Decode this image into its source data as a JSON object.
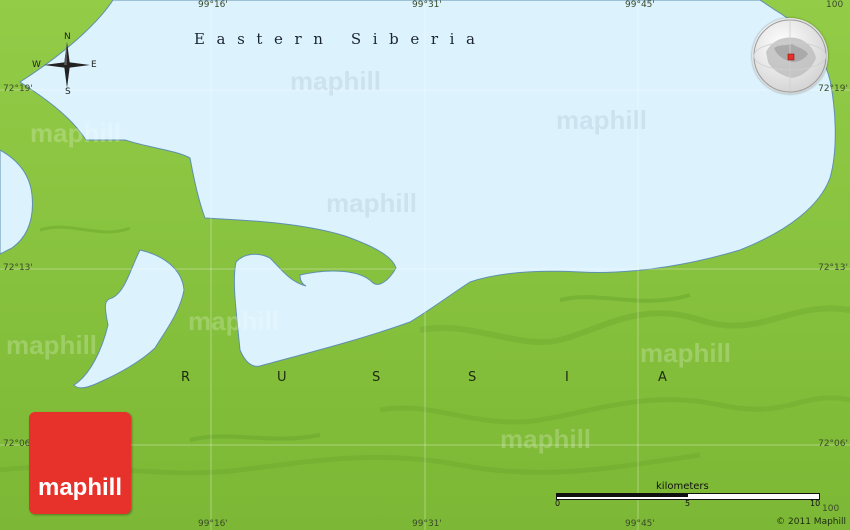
{
  "map": {
    "water_label": "Eastern Siberia",
    "country_label": "RUSSIA",
    "country_letters": [
      "R",
      "U",
      "S",
      "S",
      "I",
      "A"
    ],
    "watermark": "maphill",
    "colors": {
      "land": "#8cc63f",
      "water": "#dcf3fd",
      "coastline": "#5f8fb0",
      "grid": "#a9c89a",
      "logo": "#e7322b"
    }
  },
  "coords": {
    "top": [
      "99°16'",
      "99°31'",
      "99°45'",
      "100"
    ],
    "bottom": [
      "99°16'",
      "99°31'",
      "99°45'",
      "100"
    ],
    "left": [
      "72°19'",
      "72°13'",
      "72°06'"
    ],
    "right": [
      "72°19'",
      "72°13'",
      "72°06'"
    ]
  },
  "compass": {
    "n": "N",
    "s": "S",
    "e": "E",
    "w": "W"
  },
  "logo": {
    "text": "maphill"
  },
  "scale": {
    "title": "kilometers",
    "ticks": [
      "0",
      "5",
      "10"
    ]
  },
  "copyright": "© 2011 Maphill",
  "globe": {
    "icon": "globe-locator-icon"
  }
}
